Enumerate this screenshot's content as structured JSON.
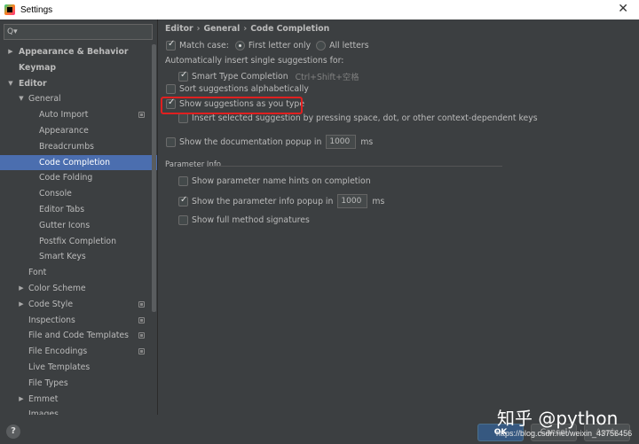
{
  "window": {
    "title": "Settings",
    "close_glyph": "✕"
  },
  "search": {
    "placeholder": "Q▾",
    "value": ""
  },
  "tree": [
    {
      "label": "Appearance & Behavior",
      "level": 0,
      "arrow": "▶",
      "bold": true,
      "cfg": false,
      "selected": false
    },
    {
      "label": "Keymap",
      "level": 0,
      "arrow": "",
      "bold": true,
      "cfg": false,
      "selected": false
    },
    {
      "label": "Editor",
      "level": 0,
      "arrow": "▼",
      "bold": true,
      "cfg": false,
      "selected": false
    },
    {
      "label": "General",
      "level": 1,
      "arrow": "▼",
      "bold": false,
      "cfg": false,
      "selected": false
    },
    {
      "label": "Auto Import",
      "level": 2,
      "arrow": "",
      "bold": false,
      "cfg": true,
      "selected": false
    },
    {
      "label": "Appearance",
      "level": 2,
      "arrow": "",
      "bold": false,
      "cfg": false,
      "selected": false
    },
    {
      "label": "Breadcrumbs",
      "level": 2,
      "arrow": "",
      "bold": false,
      "cfg": false,
      "selected": false
    },
    {
      "label": "Code Completion",
      "level": 2,
      "arrow": "",
      "bold": false,
      "cfg": false,
      "selected": true
    },
    {
      "label": "Code Folding",
      "level": 2,
      "arrow": "",
      "bold": false,
      "cfg": false,
      "selected": false
    },
    {
      "label": "Console",
      "level": 2,
      "arrow": "",
      "bold": false,
      "cfg": false,
      "selected": false
    },
    {
      "label": "Editor Tabs",
      "level": 2,
      "arrow": "",
      "bold": false,
      "cfg": false,
      "selected": false
    },
    {
      "label": "Gutter Icons",
      "level": 2,
      "arrow": "",
      "bold": false,
      "cfg": false,
      "selected": false
    },
    {
      "label": "Postfix Completion",
      "level": 2,
      "arrow": "",
      "bold": false,
      "cfg": false,
      "selected": false
    },
    {
      "label": "Smart Keys",
      "level": 2,
      "arrow": "",
      "bold": false,
      "cfg": false,
      "selected": false
    },
    {
      "label": "Font",
      "level": 1,
      "arrow": "",
      "bold": false,
      "cfg": false,
      "selected": false
    },
    {
      "label": "Color Scheme",
      "level": 1,
      "arrow": "▶",
      "bold": false,
      "cfg": false,
      "selected": false
    },
    {
      "label": "Code Style",
      "level": 1,
      "arrow": "▶",
      "bold": false,
      "cfg": true,
      "selected": false
    },
    {
      "label": "Inspections",
      "level": 1,
      "arrow": "",
      "bold": false,
      "cfg": true,
      "selected": false
    },
    {
      "label": "File and Code Templates",
      "level": 1,
      "arrow": "",
      "bold": false,
      "cfg": true,
      "selected": false
    },
    {
      "label": "File Encodings",
      "level": 1,
      "arrow": "",
      "bold": false,
      "cfg": true,
      "selected": false
    },
    {
      "label": "Live Templates",
      "level": 1,
      "arrow": "",
      "bold": false,
      "cfg": false,
      "selected": false
    },
    {
      "label": "File Types",
      "level": 1,
      "arrow": "",
      "bold": false,
      "cfg": false,
      "selected": false
    },
    {
      "label": "Emmet",
      "level": 1,
      "arrow": "▶",
      "bold": false,
      "cfg": false,
      "selected": false
    },
    {
      "label": "Images",
      "level": 1,
      "arrow": "",
      "bold": false,
      "cfg": false,
      "selected": false
    }
  ],
  "breadcrumb": {
    "part1": "Editor",
    "part2": "General",
    "part3": "Code Completion",
    "sep": "›"
  },
  "options": {
    "match_case": {
      "label": "Match case:",
      "checked": true
    },
    "first_letter_only": {
      "label": "First letter only",
      "checked": true
    },
    "all_letters": {
      "label": "All letters",
      "checked": false
    },
    "auto_insert_label": "Automatically insert single suggestions for:",
    "smart_type": {
      "label": "Smart Type Completion",
      "hint": "Ctrl+Shift+空格",
      "checked": true
    },
    "sort_alpha": {
      "label": "Sort suggestions alphabetically",
      "checked": false
    },
    "show_as_you_type": {
      "label": "Show suggestions as you type",
      "checked": true
    },
    "insert_selected": {
      "label": "Insert selected suggestion by pressing space, dot, or other context-dependent keys",
      "checked": false
    },
    "doc_popup": {
      "label": "Show the documentation popup in",
      "value": "1000",
      "unit": "ms",
      "checked": false
    }
  },
  "param_info": {
    "title": "Parameter Info",
    "name_hints": {
      "label": "Show parameter name hints on completion",
      "checked": false
    },
    "info_popup": {
      "label": "Show the parameter info popup in",
      "value": "1000",
      "unit": "ms",
      "checked": true
    },
    "full_sig": {
      "label": "Show full method signatures",
      "checked": false
    }
  },
  "buttons": {
    "help": "?",
    "ok": "OK",
    "cancel": "Cancel",
    "apply": "Apply"
  },
  "overlay": {
    "watermark": "知乎 @python",
    "url": "https://blog.csdn.net/weixin_43756456"
  },
  "colors": {
    "selection": "#4b6eaf",
    "highlight_box": "#e02020",
    "background": "#3c3f41"
  }
}
